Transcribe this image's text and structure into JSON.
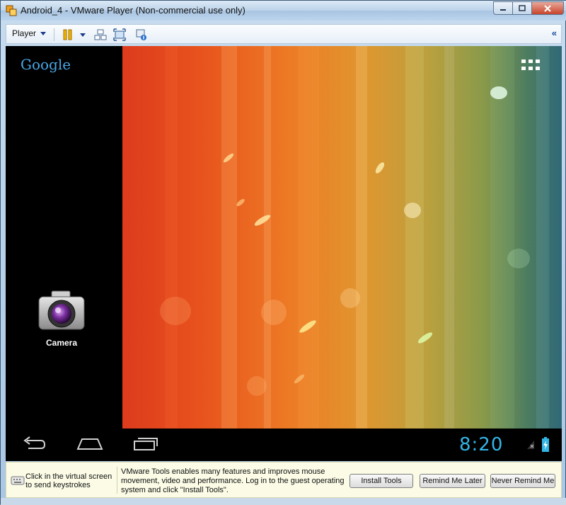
{
  "window": {
    "title": "Android_4 - VMware Player (Non-commercial use only)",
    "icon": "vmware-icon"
  },
  "toolbar": {
    "player_label": "Player",
    "icons": [
      "pause-icon",
      "send-ctrl-alt-del-icon",
      "fullscreen-icon",
      "unity-icon"
    ],
    "collapse_label": "«"
  },
  "android": {
    "search_brand": "Google",
    "apps_icon": "all-apps-grid-icon",
    "shortcut": {
      "label": "Camera",
      "icon": "camera-icon"
    },
    "nav": {
      "back": "back-icon",
      "home": "home-icon",
      "recents": "recents-icon"
    },
    "status": {
      "time": "8:20",
      "signal": "no-signal-icon",
      "battery": "battery-charging-icon"
    },
    "accent": "#33b5e5"
  },
  "infobar": {
    "hint": "Click in the virtual screen to send keystrokes",
    "message": "VMware Tools enables many features and improves mouse movement, video and performance. Log in to the guest operating system and click \"Install Tools\".",
    "install_label": "Install Tools",
    "remind_label": "Remind Me Later",
    "never_label": "Never Remind Me"
  }
}
